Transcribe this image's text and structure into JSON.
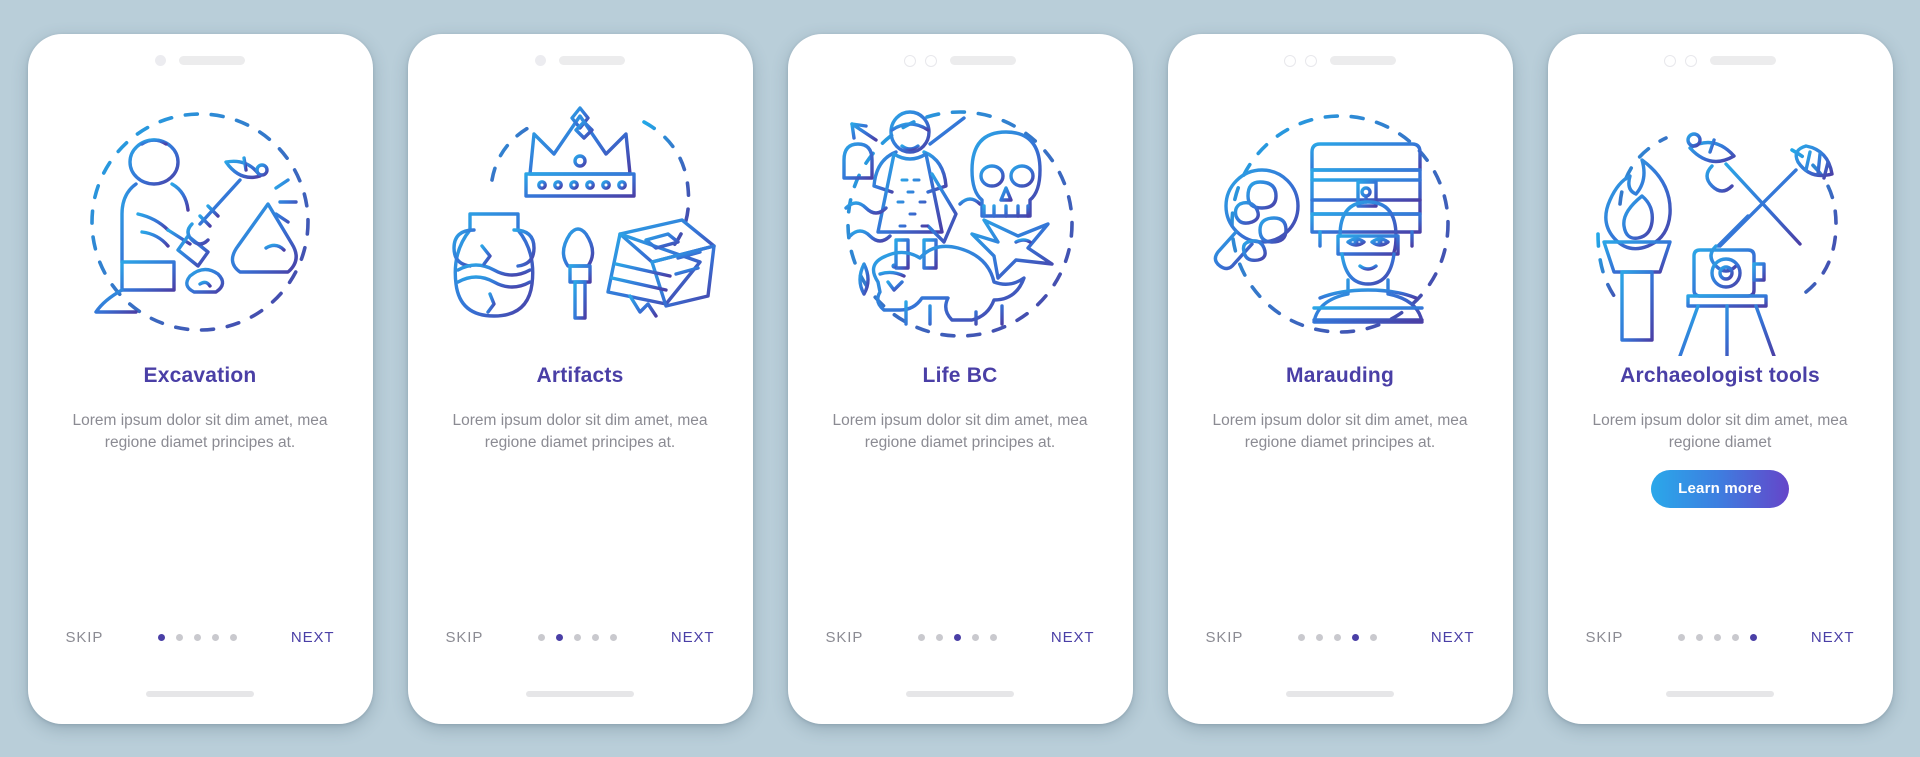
{
  "background_color": "#b9ced9",
  "theme": {
    "title_color": "#4a3fa6",
    "body_text_color": "#8b8b93",
    "next_color": "#4a3fa6",
    "dot_active_color": "#4a3fa6",
    "dot_inactive_color": "#c9c9ce",
    "cta_gradient_from": "#2aa8ea",
    "cta_gradient_to": "#6545c9",
    "illustration_stroke_from": "#29a3e0",
    "illustration_stroke_to": "#4a3fa6"
  },
  "common": {
    "skip_label": "SKIP",
    "next_label": "NEXT",
    "dot_count": 5
  },
  "screens": [
    {
      "title": "Excavation",
      "description": "Lorem ipsum dolor sit dim amet, mea regione diamet principes at.",
      "active_dot": 1,
      "has_cta": false,
      "cta_label": "",
      "notch": "single-dot",
      "illustration_name": "excavation-illustration",
      "illustration_items": [
        "archaeologist-digging",
        "pickaxe",
        "mountain-rock",
        "dashed-circle"
      ]
    },
    {
      "title": "Artifacts",
      "description": "Lorem ipsum dolor sit dim amet, mea regione diamet principes at.",
      "active_dot": 2,
      "has_cta": false,
      "cta_label": "",
      "notch": "single-dot",
      "illustration_name": "artifacts-illustration",
      "illustration_items": [
        "crown",
        "amphora-vase",
        "brush",
        "ancient-book",
        "dashed-circle"
      ]
    },
    {
      "title": "Life BC",
      "description": "Lorem ipsum dolor sit dim amet, mea regione diamet principes at.",
      "active_dot": 3,
      "has_cta": false,
      "cta_label": "",
      "notch": "double-ring",
      "illustration_name": "life-bc-illustration",
      "illustration_items": [
        "caveman",
        "skull",
        "pterodactyl",
        "dinosaur",
        "dashed-circle"
      ]
    },
    {
      "title": "Marauding",
      "description": "Lorem ipsum dolor sit dim amet, mea regione diamet principes at.",
      "active_dot": 4,
      "has_cta": false,
      "cta_label": "",
      "notch": "double-ring",
      "illustration_name": "marauding-illustration",
      "illustration_items": [
        "treasure-chest",
        "magnifier-loot",
        "masked-thief",
        "dashed-circle"
      ]
    },
    {
      "title": "Archaeologist tools",
      "description": "Lorem ipsum dolor sit dim amet, mea regione diamet",
      "active_dot": 5,
      "has_cta": true,
      "cta_label": "Learn more",
      "notch": "double-ring",
      "illustration_name": "archaeologist-tools-illustration",
      "illustration_items": [
        "torch-flame",
        "pickaxe",
        "brush",
        "camera-tripod",
        "dashed-circle"
      ]
    }
  ]
}
